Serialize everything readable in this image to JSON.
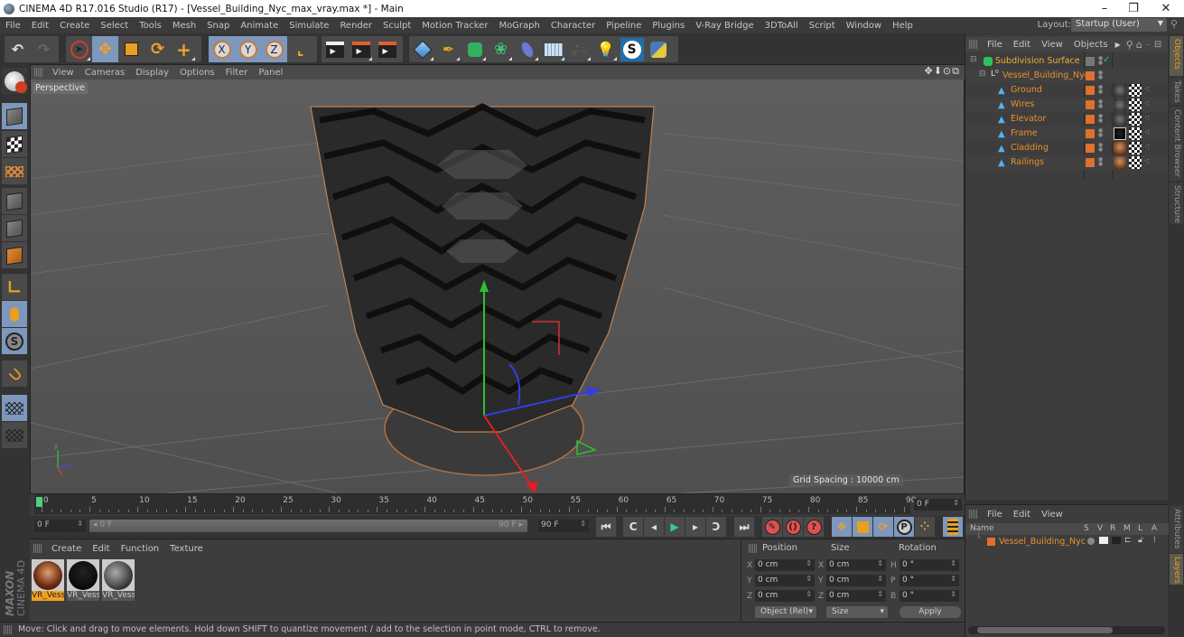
{
  "window": {
    "title": "CINEMA 4D R17.016 Studio (R17) - [Vessel_Building_Nyc_max_vray.max *] - Main",
    "controls": {
      "minimize": "–",
      "restore": "❐",
      "close": "✕"
    }
  },
  "menubar": {
    "items": [
      "File",
      "Edit",
      "Create",
      "Select",
      "Tools",
      "Mesh",
      "Snap",
      "Animate",
      "Simulate",
      "Render",
      "Sculpt",
      "Motion Tracker",
      "MoGraph",
      "Character",
      "Pipeline",
      "Plugins",
      "V-Ray Bridge",
      "3DToAll",
      "Script",
      "Window",
      "Help"
    ],
    "layout_label": "Layout:",
    "layout_value": "Startup (User)"
  },
  "toolbar": {
    "undo": "undo-icon",
    "redo": "redo-icon",
    "tools": [
      {
        "name": "live-selection",
        "active": false
      },
      {
        "name": "move",
        "active": true
      },
      {
        "name": "scale",
        "active": false
      },
      {
        "name": "rotate",
        "active": false
      },
      {
        "name": "last-tool",
        "active": false
      }
    ],
    "axes": [
      "X",
      "Y",
      "Z"
    ],
    "coord_system": "world-coordinate-icon",
    "render": [
      "render-view",
      "render-picture-viewer",
      "edit-render-settings"
    ],
    "create": [
      "cube",
      "pen-spline",
      "nurbs",
      "array",
      "deformer",
      "floor",
      "camera",
      "light",
      "3dtoall",
      "python"
    ]
  },
  "viewport": {
    "menu": [
      "View",
      "Cameras",
      "Display",
      "Options",
      "Filter",
      "Panel"
    ],
    "camera_label": "Perspective",
    "grid_spacing": "Grid Spacing : 10000 cm",
    "nav_icons": "✥⬇⊙⧉"
  },
  "timeline": {
    "ticks": [
      "0",
      "5",
      "10",
      "15",
      "20",
      "25",
      "30",
      "35",
      "40",
      "45",
      "50",
      "55",
      "60",
      "65",
      "70",
      "75",
      "80",
      "85",
      "90"
    ],
    "current_frame": "0 F",
    "start_field": "0 F",
    "range_start": "0 F",
    "range_end": "90 F",
    "end_field": "90 F",
    "end_display": "0 F"
  },
  "transport": {
    "buttons": [
      "go-to-start",
      "previous-keyframe",
      "previous-frame",
      "play",
      "next-frame",
      "next-keyframe",
      "go-to-end"
    ],
    "record": [
      "record-active",
      "autokey",
      "keyframe-selection"
    ],
    "key_modes": [
      {
        "name": "position",
        "active": true
      },
      {
        "name": "scale",
        "active": true
      },
      {
        "name": "rotation",
        "active": true
      },
      {
        "name": "parameter",
        "active": true
      },
      {
        "name": "point-level",
        "active": false
      }
    ]
  },
  "materials": {
    "menu": [
      "Create",
      "Edit",
      "Function",
      "Texture"
    ],
    "items": [
      {
        "label": "VR_Vess",
        "selected": true,
        "swatch": "copper"
      },
      {
        "label": "VR_Vess",
        "selected": false,
        "swatch": "black"
      },
      {
        "label": "VR_Vess",
        "selected": false,
        "swatch": "gray"
      }
    ],
    "brand": "MAXON CINEMA 4D"
  },
  "coordinates": {
    "headers": [
      "Position",
      "Size",
      "Rotation"
    ],
    "rows": [
      {
        "pos_axis": "X",
        "pos": "0 cm",
        "size_axis": "X",
        "size": "0 cm",
        "rot_axis": "H",
        "rot": "0 °"
      },
      {
        "pos_axis": "Y",
        "pos": "0 cm",
        "size_axis": "Y",
        "size": "0 cm",
        "rot_axis": "P",
        "rot": "0 °"
      },
      {
        "pos_axis": "Z",
        "pos": "0 cm",
        "size_axis": "Z",
        "size": "0 cm",
        "rot_axis": "B",
        "rot": "0 °"
      }
    ],
    "mode_select": "Object (Rel)",
    "size_select": "Size",
    "apply": "Apply"
  },
  "status": "Move: Click and drag to move elements. Hold down SHIFT to quantize movement / add to the selection in point mode, CTRL to remove.",
  "object_manager": {
    "menu": [
      "File",
      "Edit",
      "View",
      "Objects"
    ],
    "objects": [
      {
        "name": "Subdivision Surface",
        "level": 0,
        "icon": "subdivision-icon",
        "color": "#e8a020"
      },
      {
        "name": "Vessel_Building_Nyc",
        "level": 1,
        "icon": "null-icon",
        "color": "#e07a20"
      },
      {
        "name": "Ground",
        "level": 2,
        "icon": "polygon-icon",
        "material": "gray"
      },
      {
        "name": "Wires",
        "level": 2,
        "icon": "polygon-icon",
        "material": "gray"
      },
      {
        "name": "Elevator",
        "level": 2,
        "icon": "polygon-icon",
        "material": "gray"
      },
      {
        "name": "Frame",
        "level": 2,
        "icon": "polygon-icon",
        "material": "black"
      },
      {
        "name": "Cladding",
        "level": 2,
        "icon": "polygon-icon",
        "material": "copper"
      },
      {
        "name": "Railings",
        "level": 2,
        "icon": "polygon-icon",
        "material": "copper"
      }
    ]
  },
  "side_tabs": {
    "top": [
      {
        "label": "Objects",
        "selected": true
      },
      {
        "label": "Takes",
        "selected": false
      },
      {
        "label": "Content Browser",
        "selected": false
      },
      {
        "label": "Structure",
        "selected": false
      }
    ],
    "bottom": [
      {
        "label": "Attributes",
        "selected": false
      },
      {
        "label": "Layers",
        "selected": true
      }
    ]
  },
  "layer_manager": {
    "menu": [
      "File",
      "Edit",
      "View"
    ],
    "columns": [
      "Name",
      "S",
      "V",
      "R",
      "M",
      "L",
      "A"
    ],
    "layers": [
      {
        "name": "Vessel_Building_Nyc",
        "color": "#e07030"
      }
    ]
  }
}
